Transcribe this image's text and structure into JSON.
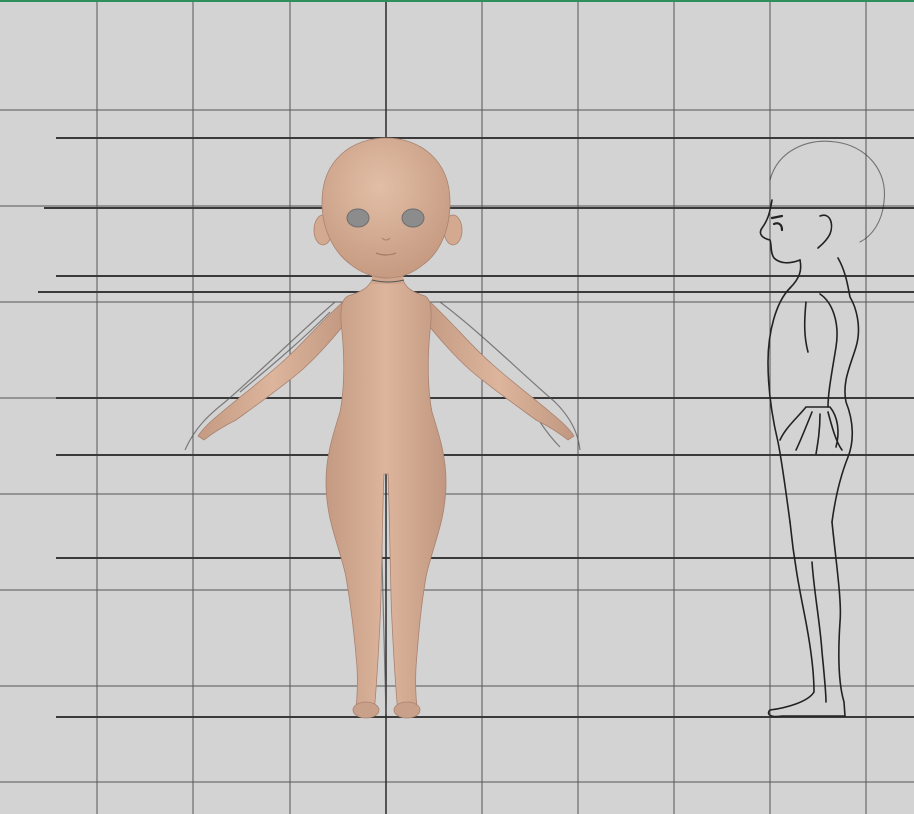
{
  "viewport": {
    "name": "front-orthographic-viewport",
    "background_color": "#d3d3d3",
    "grid_color": "#555555",
    "guide_line_color": "#3a3a3a",
    "origin_axis_color": "#2b2b2b",
    "frame_accent_color": "#2f8f5a"
  },
  "model": {
    "name": "character-base-mesh",
    "pose": "A-pose",
    "skin_color": "#d8b197",
    "skin_shadow_color": "#b98f78",
    "eye_color": "#8c8c8c"
  },
  "reference_sketch": {
    "name": "side-view-reference-sketch",
    "stroke_color": "#222222"
  }
}
